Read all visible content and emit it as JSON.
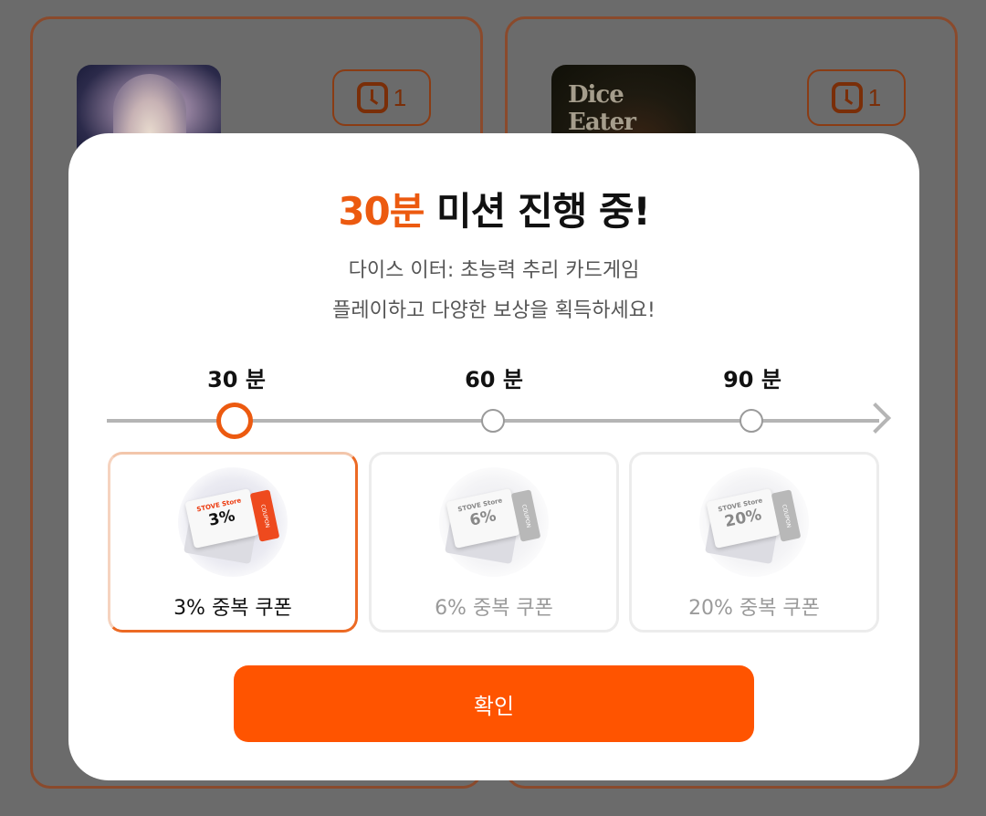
{
  "background": {
    "cards": [
      {
        "game_logo": "",
        "timer_count": "1"
      },
      {
        "game_logo": "Dice Eater",
        "timer_count": "1"
      }
    ]
  },
  "modal": {
    "title_accent": "30분",
    "title_rest": " 미션 진행 중!",
    "subtitle_line1": "다이스 이터: 초능력 추리 카드게임",
    "subtitle_line2": "플레이하고 다양한 보상을 획득하세요!",
    "steps": [
      {
        "label": "30 분",
        "active": true
      },
      {
        "label": "60 분",
        "active": false
      },
      {
        "label": "90 분",
        "active": false
      }
    ],
    "rewards": [
      {
        "brand": "STOVE Store",
        "percent": "3%",
        "stub": "COUPON",
        "label": "3% 중복 쿠폰",
        "active": true
      },
      {
        "brand": "STOVE Store",
        "percent": "6%",
        "stub": "COUPON",
        "label": "6% 중복 쿠폰",
        "active": false
      },
      {
        "brand": "STOVE Store",
        "percent": "20%",
        "stub": "COUPON",
        "label": "20% 중복 쿠폰",
        "active": false
      }
    ],
    "confirm_label": "확인"
  },
  "colors": {
    "accent": "#ec5a10",
    "button": "#ff5400",
    "overlay": "#6b6b6b",
    "inactive": "#9a9a9a"
  },
  "icons": [
    "clock-icon",
    "coupon-icon",
    "arrow-right-icon"
  ]
}
